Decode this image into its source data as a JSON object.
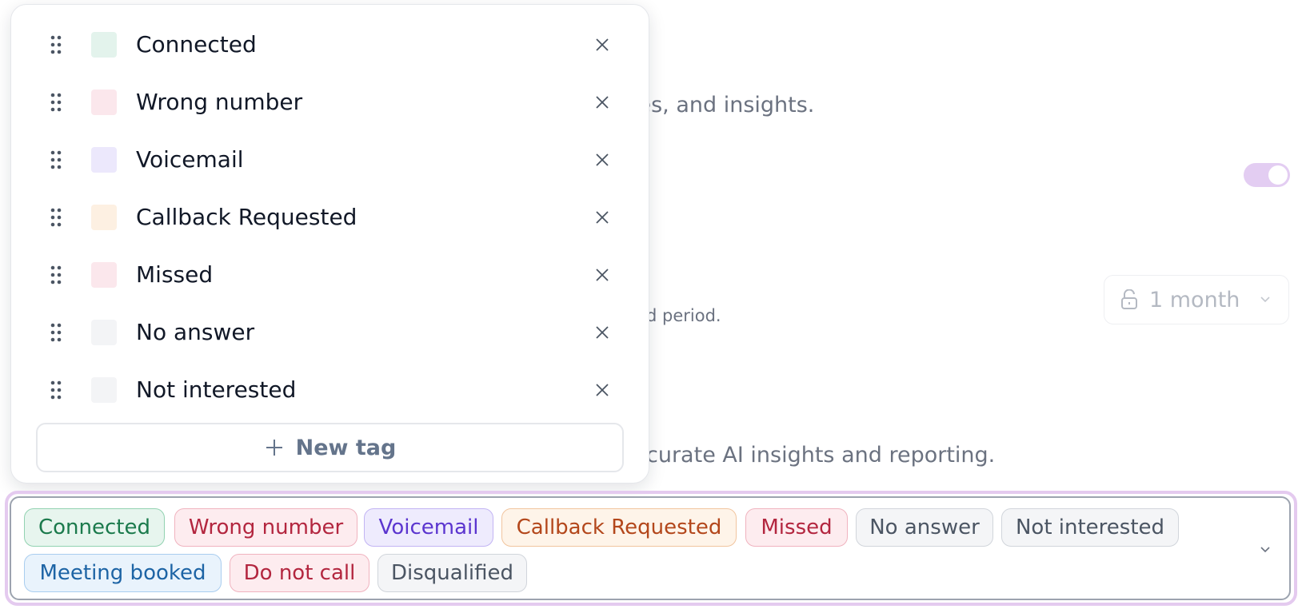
{
  "background": {
    "description_1": "ies, and insights.",
    "description_2": "d period.",
    "description_3": "curate AI insights and reporting.",
    "retention_select": {
      "value": "1 month",
      "icon": "lock-icon"
    },
    "toggle": {
      "state": "on",
      "color": "#e3cdf2"
    }
  },
  "tag_panel": {
    "tags": [
      {
        "label": "Connected",
        "color": "#e3f3ec"
      },
      {
        "label": "Wrong number",
        "color": "#fbe7ec"
      },
      {
        "label": "Voicemail",
        "color": "#ece8fc"
      },
      {
        "label": "Callback Requested",
        "color": "#fdf0e2"
      },
      {
        "label": "Missed",
        "color": "#fbe7ec"
      },
      {
        "label": "No answer",
        "color": "#f3f4f6"
      },
      {
        "label": "Not interested",
        "color": "#f3f4f6"
      }
    ],
    "new_tag_label": "New tag"
  },
  "selected_tags": [
    {
      "label": "Connected",
      "text": "#1b7a4c",
      "bg": "#e7f5ee",
      "border": "#92d2b1"
    },
    {
      "label": "Wrong number",
      "text": "#b3263f",
      "bg": "#fdecef",
      "border": "#f0b3bf"
    },
    {
      "label": "Voicemail",
      "text": "#5b35cf",
      "bg": "#eeebfd",
      "border": "#c2b4f3"
    },
    {
      "label": "Callback Requested",
      "text": "#b3471b",
      "bg": "#fef4e9",
      "border": "#f1c59f"
    },
    {
      "label": "Missed",
      "text": "#b3263f",
      "bg": "#fdecef",
      "border": "#f0b3bf"
    },
    {
      "label": "No answer",
      "text": "#4b5563",
      "bg": "#f4f5f7",
      "border": "#d1d5db"
    },
    {
      "label": "Not interested",
      "text": "#4b5563",
      "bg": "#f4f5f7",
      "border": "#d1d5db"
    },
    {
      "label": "Meeting booked",
      "text": "#1d64a5",
      "bg": "#e9f3fc",
      "border": "#a9cdef"
    },
    {
      "label": "Do not call",
      "text": "#b3263f",
      "bg": "#fdecef",
      "border": "#f0b3bf"
    },
    {
      "label": "Disqualified",
      "text": "#4b5563",
      "bg": "#f4f5f7",
      "border": "#d1d5db"
    }
  ]
}
